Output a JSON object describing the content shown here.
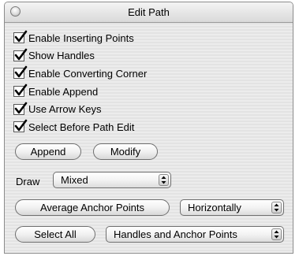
{
  "window": {
    "title": "Edit Path"
  },
  "checkboxes": [
    {
      "label": "Enable Inserting Points",
      "checked": true
    },
    {
      "label": "Show Handles",
      "checked": true
    },
    {
      "label": "Enable Converting Corner",
      "checked": true
    },
    {
      "label": "Enable Append",
      "checked": true
    },
    {
      "label": "Use Arrow Keys",
      "checked": true
    },
    {
      "label": "Select Before Path Edit",
      "checked": true
    }
  ],
  "buttons": {
    "append": "Append",
    "modify": "Modify",
    "average": "Average Anchor Points",
    "select_all": "Select All"
  },
  "draw": {
    "label": "Draw",
    "selected": "Mixed"
  },
  "average_direction": {
    "selected": "Horizontally"
  },
  "select_target": {
    "selected": "Handles and Anchor Points"
  }
}
